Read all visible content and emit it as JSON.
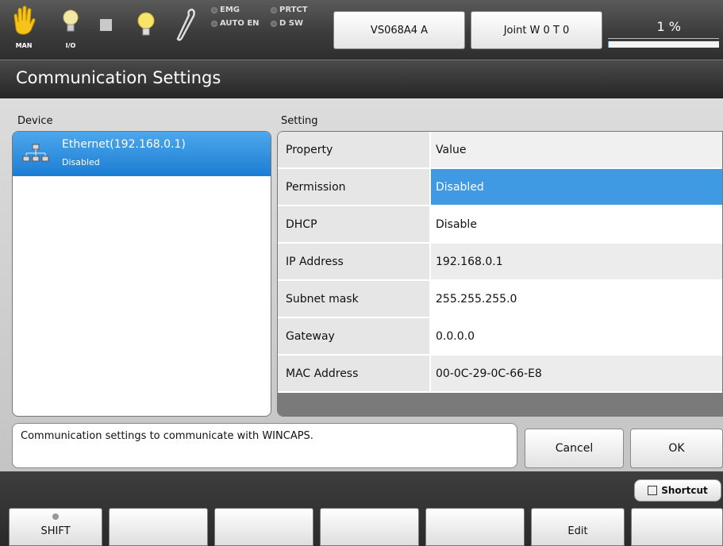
{
  "statusbar": {
    "icons": [
      {
        "name": "hand-icon",
        "caption": "MAN"
      },
      {
        "name": "lightbulb-icon",
        "caption": "I/O"
      },
      {
        "name": "stop-square-icon",
        "caption": ""
      },
      {
        "name": "lamp-icon",
        "caption": ""
      },
      {
        "name": "wrench-icon",
        "caption": ""
      }
    ],
    "leds": {
      "emg": "EMG",
      "auto_en": "AUTO EN",
      "prtct": "PRTCT",
      "d_sw": "D SW"
    },
    "robot_button": "VS068A4 A",
    "joint_button": "Joint W 0 T 0",
    "speed_label": "1 %",
    "speed_value": 1
  },
  "title": "Communication Settings",
  "device_panel": {
    "label": "Device",
    "items": [
      {
        "name": "Ethernet(192.168.0.1)",
        "status": "Disabled",
        "icon": "network-icon"
      }
    ]
  },
  "setting_panel": {
    "label": "Setting",
    "header": {
      "property": "Property",
      "value": "Value"
    },
    "rows": [
      {
        "property": "Permission",
        "value": "Disabled"
      },
      {
        "property": "DHCP",
        "value": "Disable"
      },
      {
        "property": "IP Address",
        "value": "192.168.0.1"
      },
      {
        "property": "Subnet mask",
        "value": "255.255.255.0"
      },
      {
        "property": "Gateway",
        "value": "0.0.0.0"
      },
      {
        "property": "MAC Address",
        "value": "00-0C-29-0C-66-E8"
      }
    ]
  },
  "message": "Communication settings to communicate with WINCAPS.",
  "buttons": {
    "cancel": "Cancel",
    "ok": "OK"
  },
  "shortcut": "Shortcut",
  "function_keys": [
    "SHIFT",
    "",
    "",
    "",
    "",
    "Edit",
    ""
  ],
  "colors": {
    "selection": "#3f9ae3",
    "device_selected": "#1b7dd2"
  }
}
